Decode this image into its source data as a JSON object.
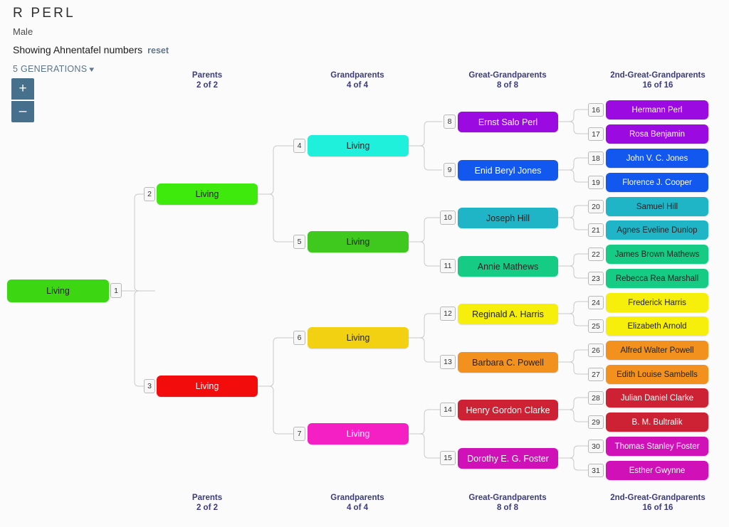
{
  "header": {
    "name": "R PERL",
    "sex": "Male",
    "showing_text": "Showing Ahnentafel numbers",
    "reset_label": "reset",
    "generations_label": "5 GENERATIONS",
    "caret_icon": "chevron-down-icon"
  },
  "zoom_controls": {
    "zoom_in_label": "+",
    "zoom_out_label": "–",
    "button_color": "#46708b"
  },
  "column_labels": [
    {
      "title": "Parents",
      "count": "2 of 2"
    },
    {
      "title": "Grandparents",
      "count": "4 of 4"
    },
    {
      "title": "Great-Grandparents",
      "count": "8 of 8"
    },
    {
      "title": "2nd-Great-Grandparents",
      "count": "16 of 16"
    }
  ],
  "label_color": "#3b3b80",
  "nodes": [
    {
      "ahnentafel": "1",
      "name": "Living",
      "bg": "#3dd613",
      "fg": "#222222"
    },
    {
      "ahnentafel": "2",
      "name": "Living",
      "bg": "#3dea0b",
      "fg": "#222222"
    },
    {
      "ahnentafel": "3",
      "name": "Living",
      "bg": "#f20c0c",
      "fg": "#ffffff"
    },
    {
      "ahnentafel": "4",
      "name": "Living",
      "bg": "#1ff0dc",
      "fg": "#222222"
    },
    {
      "ahnentafel": "5",
      "name": "Living",
      "bg": "#3fc81e",
      "fg": "#222222"
    },
    {
      "ahnentafel": "6",
      "name": "Living",
      "bg": "#f2d112",
      "fg": "#222222"
    },
    {
      "ahnentafel": "7",
      "name": "Living",
      "bg": "#f520c4",
      "fg": "#ffffff"
    },
    {
      "ahnentafel": "8",
      "name": "Ernst Salo Perl",
      "bg": "#9b0ae0",
      "fg": "#ffffff"
    },
    {
      "ahnentafel": "9",
      "name": "Enid Beryl Jones",
      "bg": "#1358ee",
      "fg": "#ffffff"
    },
    {
      "ahnentafel": "10",
      "name": "Joseph Hill",
      "bg": "#1fb4c6",
      "fg": "#222222"
    },
    {
      "ahnentafel": "11",
      "name": "Annie Mathews",
      "bg": "#16cc84",
      "fg": "#222222"
    },
    {
      "ahnentafel": "12",
      "name": "Reginald A. Harris",
      "bg": "#f6ef0c",
      "fg": "#222222"
    },
    {
      "ahnentafel": "13",
      "name": "Barbara C. Powell",
      "bg": "#f2911e",
      "fg": "#222222"
    },
    {
      "ahnentafel": "14",
      "name": "Henry Gordon Clarke",
      "bg": "#cc2233",
      "fg": "#ffffff"
    },
    {
      "ahnentafel": "15",
      "name": "Dorothy E. G. Foster",
      "bg": "#d011b8",
      "fg": "#ffffff"
    },
    {
      "ahnentafel": "16",
      "name": "Hermann Perl",
      "bg": "#9b0ae0",
      "fg": "#ffffff"
    },
    {
      "ahnentafel": "17",
      "name": "Rosa Benjamin",
      "bg": "#9b0ae0",
      "fg": "#ffffff"
    },
    {
      "ahnentafel": "18",
      "name": "John V. C. Jones",
      "bg": "#1358ee",
      "fg": "#ffffff"
    },
    {
      "ahnentafel": "19",
      "name": "Florence J. Cooper",
      "bg": "#1358ee",
      "fg": "#ffffff"
    },
    {
      "ahnentafel": "20",
      "name": "Samuel Hill",
      "bg": "#1fb4c6",
      "fg": "#222222"
    },
    {
      "ahnentafel": "21",
      "name": "Agnes Eveline Dunlop",
      "bg": "#1fb4c6",
      "fg": "#222222"
    },
    {
      "ahnentafel": "22",
      "name": "James Brown Mathews",
      "bg": "#16cc84",
      "fg": "#222222"
    },
    {
      "ahnentafel": "23",
      "name": "Rebecca Rea Marshall",
      "bg": "#16cc84",
      "fg": "#222222"
    },
    {
      "ahnentafel": "24",
      "name": "Frederick Harris",
      "bg": "#f6ef0c",
      "fg": "#222222"
    },
    {
      "ahnentafel": "25",
      "name": "Elizabeth Arnold",
      "bg": "#f6ef0c",
      "fg": "#222222"
    },
    {
      "ahnentafel": "26",
      "name": "Alfred Walter Powell",
      "bg": "#f2911e",
      "fg": "#222222"
    },
    {
      "ahnentafel": "27",
      "name": "Edith Louise Sambells",
      "bg": "#f2911e",
      "fg": "#222222"
    },
    {
      "ahnentafel": "28",
      "name": "Julian Daniel Clarke",
      "bg": "#cc2233",
      "fg": "#ffffff"
    },
    {
      "ahnentafel": "29",
      "name": "B. M. Bultralik",
      "bg": "#cc2233",
      "fg": "#ffffff"
    },
    {
      "ahnentafel": "30",
      "name": "Thomas Stanley Foster",
      "bg": "#d011b8",
      "fg": "#ffffff"
    },
    {
      "ahnentafel": "31",
      "name": "Esther Gwynne",
      "bg": "#d011b8",
      "fg": "#ffffff"
    }
  ]
}
